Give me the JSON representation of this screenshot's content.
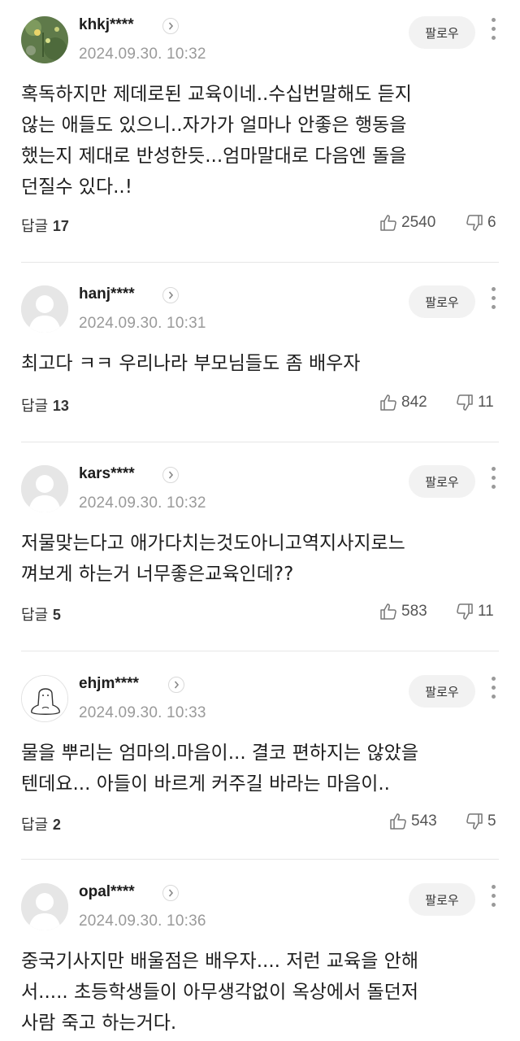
{
  "labels": {
    "follow": "팔로우",
    "reply": "답글"
  },
  "comments": [
    {
      "username": "khkj****",
      "timestamp": "2024.09.30. 10:32",
      "avatar": "photo",
      "body": "혹독하지만 제데로된 교육이네..수십번말해도 듣지\n않는 애들도 있으니..자가가 얼마나 안좋은 행동을\n했는지 제대로 반성한듯...엄마말대로 다음엔 돌을\n던질수 있다..!",
      "replies": "17",
      "likes": "2540",
      "dislikes": "6"
    },
    {
      "username": "hanj****",
      "timestamp": "2024.09.30. 10:31",
      "avatar": "default",
      "body": "최고다 ㅋㅋ 우리나라 부모님들도 좀 배우자",
      "replies": "13",
      "likes": "842",
      "dislikes": "11"
    },
    {
      "username": "kars****",
      "timestamp": "2024.09.30. 10:32",
      "avatar": "default",
      "body": "저물맞는다고 애가다치는것도아니고역지사지로느\n껴보게 하는거 너무좋은교육인데??",
      "replies": "5",
      "likes": "583",
      "dislikes": "11"
    },
    {
      "username": "ehjm****",
      "timestamp": "2024.09.30. 10:33",
      "avatar": "drawing",
      "body": "물을 뿌리는 엄마의.마음이... 결코 편하지는 않았을\n텐데요... 아들이 바르게 커주길 바라는 마음이..",
      "replies": "2",
      "likes": "543",
      "dislikes": "5"
    },
    {
      "username": "opal****",
      "timestamp": "2024.09.30. 10:36",
      "avatar": "default",
      "body": "중국기사지만 배울점은 배우자.... 저런 교육을 안해\n서..... 초등학생들이 아무생각없이 옥상에서 돌던저\n사람 죽고 하는거다.",
      "replies": null,
      "likes": null,
      "dislikes": null
    }
  ]
}
